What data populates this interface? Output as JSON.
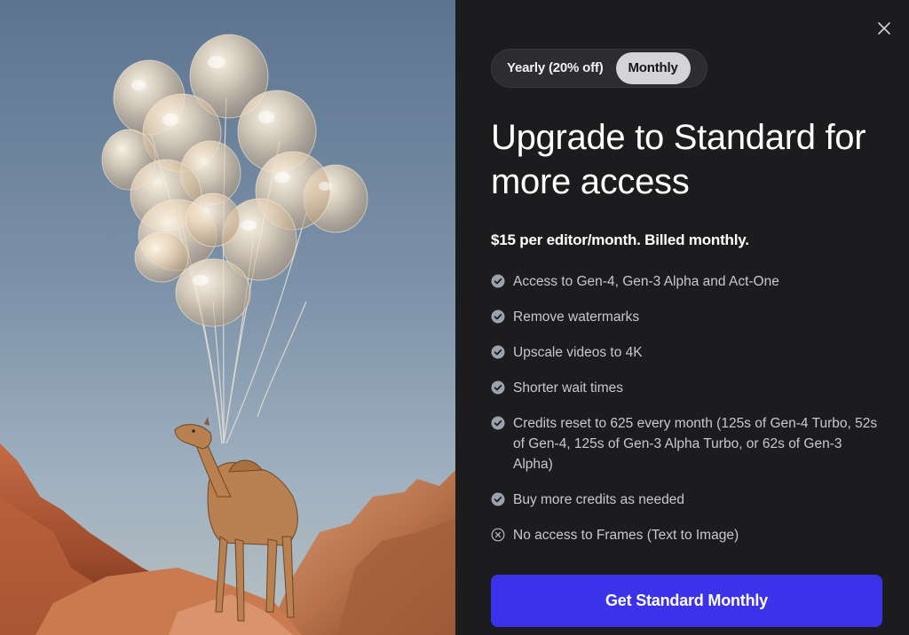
{
  "billing_toggle": {
    "yearly_label": "Yearly (20% off)",
    "monthly_label": "Monthly",
    "selected": "Monthly"
  },
  "title": "Upgrade to Standard for more access",
  "price_line": "$15 per editor/month. Billed monthly.",
  "features": [
    {
      "text": "Access to Gen-4, Gen-3 Alpha and Act-One",
      "icon": "check-circle-icon",
      "included": true
    },
    {
      "text": "Remove watermarks",
      "icon": "check-circle-icon",
      "included": true
    },
    {
      "text": "Upscale videos to 4K",
      "icon": "check-circle-icon",
      "included": true
    },
    {
      "text": "Shorter wait times",
      "icon": "check-circle-icon",
      "included": true
    },
    {
      "text": "Credits reset to 625 every month (125s of Gen-4 Turbo, 52s of Gen-4, 125s of Gen-3 Alpha Turbo, or 62s of Gen-3 Alpha)",
      "icon": "check-circle-icon",
      "included": true
    },
    {
      "text": "Buy more credits as needed",
      "icon": "check-circle-icon",
      "included": true
    },
    {
      "text": "No access to Frames (Text to Image)",
      "icon": "x-circle-icon",
      "included": false
    }
  ],
  "cta_label": "Get Standard Monthly",
  "colors": {
    "panel_bg": "#1c1c1f",
    "accent": "#3a33ea",
    "check_icon": "#9aa3ad",
    "feature_text": "#c9c9cd"
  },
  "hero_image": {
    "icon": "hero-illustration",
    "depicts": "camel holding balloons in desert"
  }
}
